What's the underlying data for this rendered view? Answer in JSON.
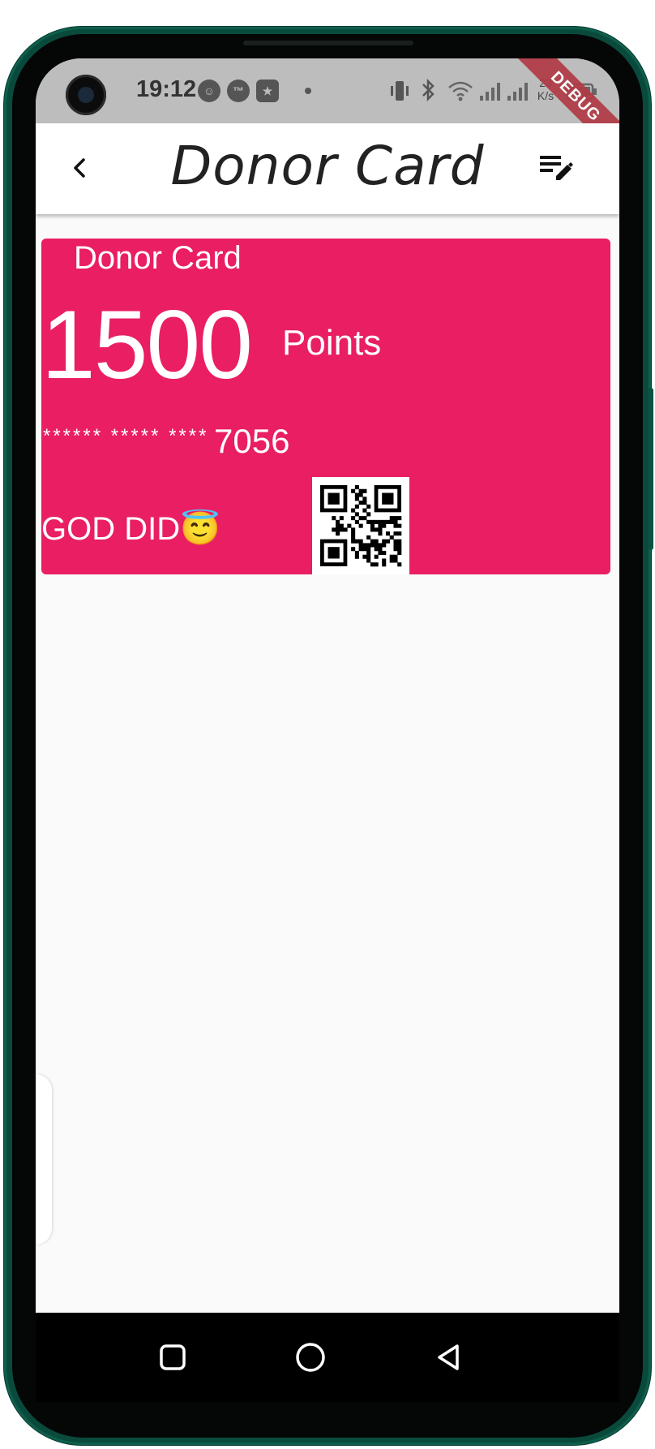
{
  "status_bar": {
    "time": "19:12",
    "notification_icons": [
      "baby-face-icon",
      "tm-icon",
      "star-app-icon"
    ],
    "net_speed_value": "23",
    "net_speed_unit": "K/s",
    "debug_ribbon": "DEBUG"
  },
  "app_bar": {
    "title": "Donor Card",
    "back_icon": "chevron-left-icon",
    "edit_icon": "edit-note-icon"
  },
  "card": {
    "label": "Donor Card",
    "points_value": "1500",
    "points_unit": "Points",
    "masked_number": "****** ***** ****",
    "last_digits": "7056",
    "motto": "GOD DID😇",
    "background_color": "#e91e63",
    "qr_icon": "qr-code-icon"
  },
  "nav_bar": {
    "recents_icon": "square-icon",
    "home_icon": "circle-icon",
    "back_icon": "triangle-back-icon"
  }
}
